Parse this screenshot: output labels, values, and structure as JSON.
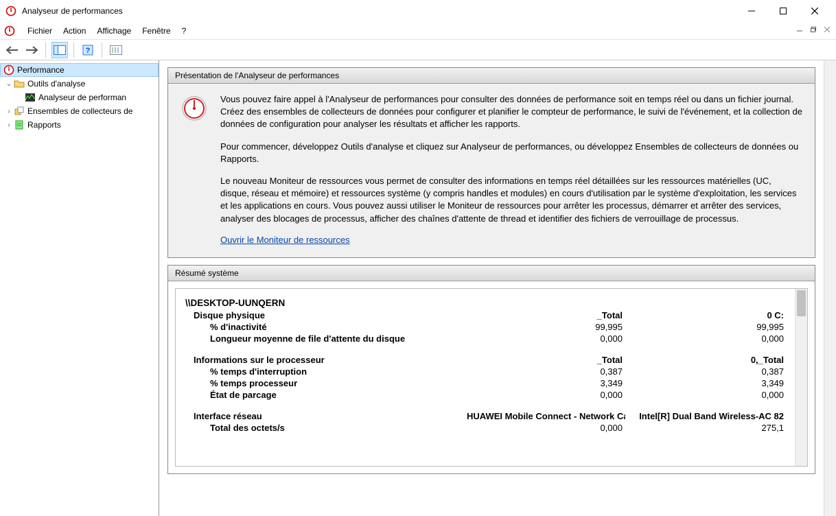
{
  "window": {
    "title": "Analyseur de performances"
  },
  "menu": {
    "items": [
      "Fichier",
      "Action",
      "Affichage",
      "Fenêtre",
      "?"
    ]
  },
  "tree": {
    "root": "Performance",
    "nodes": {
      "tools": "Outils d'analyse",
      "perfmon": "Analyseur de performan",
      "collectors": "Ensembles de collecteurs de",
      "reports": "Rapports"
    }
  },
  "panels": {
    "overview_title": "Présentation de l'Analyseur de performances",
    "summary_title": "Résumé système"
  },
  "overview": {
    "p1": "Vous pouvez faire appel à l'Analyseur de performances pour consulter des données de performance soit en temps réel ou dans un fichier journal. Créez des ensembles de collecteurs de données pour configurer et planifier le compteur de performance, le suivi de l'événement, et la collection de données de configuration pour analyser les résultats et afficher les rapports.",
    "p2": "Pour commencer, développez Outils d'analyse et cliquez sur Analyseur de performances, ou développez Ensembles de collecteurs de données ou Rapports.",
    "p3": "Le nouveau Moniteur de ressources vous permet de consulter des informations en temps réel détaillées sur les ressources matérielles (UC, disque, réseau et mémoire) et ressources système (y compris handles et modules) en cours d'utilisation par le système d'exploitation, les services et les applications en cours. Vous pouvez aussi utiliser le Moniteur de ressources pour arrêter les processus, démarrer et arrêter des services, analyser des blocages de processus, afficher des chaînes d'attente de thread et identifier des fichiers de verrouillage de processus.",
    "link": "Ouvrir le Moniteur de ressources"
  },
  "summary": {
    "host": "\\\\DESKTOP-UUNQERN",
    "disk": {
      "label": "Disque physique",
      "col1": "_Total",
      "col2": "0 C:",
      "rows": [
        {
          "label": "% d'inactivité",
          "v1": "99,995",
          "v2": "99,995"
        },
        {
          "label": "Longueur moyenne de file d'attente du disque",
          "v1": "0,000",
          "v2": "0,000"
        }
      ]
    },
    "cpu": {
      "label": "Informations sur le processeur",
      "col1": "_Total",
      "col2": "0,_Total",
      "rows": [
        {
          "label": "% temps d'interruption",
          "v1": "0,387",
          "v2": "0,387"
        },
        {
          "label": "% temps processeur",
          "v1": "3,349",
          "v2": "3,349"
        },
        {
          "label": "État de parcage",
          "v1": "0,000",
          "v2": "0,000"
        }
      ]
    },
    "net": {
      "label": "Interface réseau",
      "col1": "HUAWEI Mobile Connect - Network Card",
      "col2": "Intel[R] Dual Band Wireless-AC 82",
      "rows": [
        {
          "label": "Total des octets/s",
          "v1": "0,000",
          "v2": "275,1"
        }
      ]
    }
  }
}
